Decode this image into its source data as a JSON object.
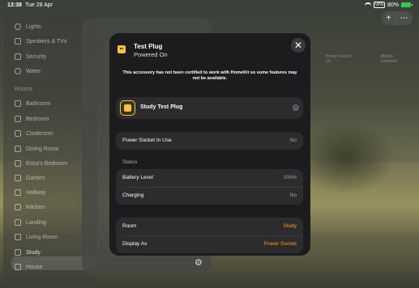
{
  "status_bar": {
    "time": "13:38",
    "date": "Tue 28 Apr",
    "vpn": "VPN",
    "battery": "80%"
  },
  "sidebar": {
    "items_top": [
      {
        "label": "Lights"
      },
      {
        "label": "Speakers & TVs"
      },
      {
        "label": "Security"
      },
      {
        "label": "Water"
      }
    ],
    "rooms_header": "Rooms",
    "rooms": [
      "Bathroom",
      "Bedroom",
      "Cloakroom",
      "Dining Room",
      "Erica's Bedroom",
      "Garden",
      "Hallway",
      "Kitchen",
      "Landing",
      "Living Room",
      "Study",
      "House"
    ],
    "selected": "Study"
  },
  "top_buttons": {
    "add": "+",
    "more": "⋯"
  },
  "background_tiles": [
    {
      "line1": "Power Socket",
      "line2": "On"
    },
    {
      "line1": "Motion",
      "line2": "Detected"
    }
  ],
  "modal": {
    "title": "Test Plug",
    "subtitle": "Powered On",
    "close": "✕",
    "warning": "This accessory has not been certified to work with HomeKit so some features may not be available.",
    "tile": {
      "label": "Study Test Plug",
      "clear": "✕"
    },
    "power_row": {
      "label": "Power Socket In Use",
      "value": "No"
    },
    "status_header": "Status",
    "status_rows": [
      {
        "label": "Battery Level",
        "value": "100%"
      },
      {
        "label": "Charging",
        "value": "No"
      }
    ],
    "room_rows": [
      {
        "label": "Room",
        "value": "Study"
      },
      {
        "label": "Display As",
        "value": "Power Socket"
      }
    ]
  },
  "colors": {
    "accent": "#ff9f0a",
    "plug": "#f5c242",
    "modal_bg": "#1c1c1e",
    "card_bg": "#2c2c2e"
  }
}
